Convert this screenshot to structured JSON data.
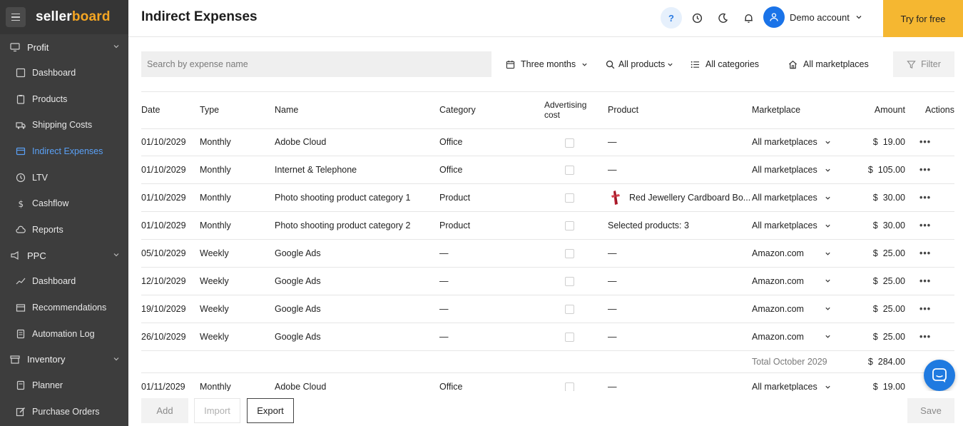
{
  "brand": {
    "part1": "seller",
    "part2": "board"
  },
  "sidebar": {
    "sections": [
      {
        "label": "Profit",
        "icon": "monitor-icon",
        "items": [
          {
            "label": "Dashboard",
            "icon": "dashboard-icon",
            "active": false
          },
          {
            "label": "Products",
            "icon": "clipboard-icon",
            "active": false
          },
          {
            "label": "Shipping Costs",
            "icon": "truck-icon",
            "active": false
          },
          {
            "label": "Indirect Expenses",
            "icon": "expenses-icon",
            "active": true
          },
          {
            "label": "LTV",
            "icon": "clock-icon",
            "active": false
          },
          {
            "label": "Cashflow",
            "icon": "dollar-icon",
            "active": false
          },
          {
            "label": "Reports",
            "icon": "cloud-icon",
            "active": false
          }
        ]
      },
      {
        "label": "PPC",
        "icon": "megaphone-icon",
        "items": [
          {
            "label": "Dashboard",
            "icon": "trend-icon",
            "active": false
          },
          {
            "label": "Recommendations",
            "icon": "box-icon",
            "active": false
          },
          {
            "label": "Automation Log",
            "icon": "log-icon",
            "active": false
          }
        ]
      },
      {
        "label": "Inventory",
        "icon": "inventory-icon",
        "items": [
          {
            "label": "Planner",
            "icon": "planner-icon",
            "active": false
          },
          {
            "label": "Purchase Orders",
            "icon": "edit-icon",
            "active": false
          }
        ]
      }
    ]
  },
  "header": {
    "title": "Indirect Expenses",
    "help": "?",
    "account_name": "Demo account",
    "try_label": "Try for free"
  },
  "toolbar": {
    "search_placeholder": "Search by expense name",
    "period": "Three months",
    "products": "All products",
    "categories": "All categories",
    "marketplaces": "All marketplaces",
    "filter": "Filter"
  },
  "table": {
    "columns": [
      "Date",
      "Type",
      "Name",
      "Category",
      "Advertising cost",
      "Product",
      "Marketplace",
      "Amount",
      "Actions"
    ],
    "rows": [
      {
        "date": "01/10/2029",
        "type": "Monthly",
        "name": "Adobe Cloud",
        "category": "Office",
        "product": "—",
        "marketplace": "All marketplaces",
        "currency": "$",
        "amount": "19.00"
      },
      {
        "date": "01/10/2029",
        "type": "Monthly",
        "name": "Internet & Telephone",
        "category": "Office",
        "product": "—",
        "marketplace": "All marketplaces",
        "currency": "$",
        "amount": "105.00"
      },
      {
        "date": "01/10/2029",
        "type": "Monthly",
        "name": "Photo shooting product category 1",
        "category": "Product",
        "product": "Red Jewellery Cardboard Bo...",
        "marketplace": "All marketplaces",
        "currency": "$",
        "amount": "30.00"
      },
      {
        "date": "01/10/2029",
        "type": "Monthly",
        "name": "Photo shooting product category 2",
        "category": "Product",
        "product": "Selected products: 3",
        "marketplace": "All marketplaces",
        "currency": "$",
        "amount": "30.00"
      },
      {
        "date": "05/10/2029",
        "type": "Weekly",
        "name": "Google Ads",
        "category": "—",
        "product": "—",
        "marketplace": "Amazon.com",
        "currency": "$",
        "amount": "25.00"
      },
      {
        "date": "12/10/2029",
        "type": "Weekly",
        "name": "Google Ads",
        "category": "—",
        "product": "—",
        "marketplace": "Amazon.com",
        "currency": "$",
        "amount": "25.00"
      },
      {
        "date": "19/10/2029",
        "type": "Weekly",
        "name": "Google Ads",
        "category": "—",
        "product": "—",
        "marketplace": "Amazon.com",
        "currency": "$",
        "amount": "25.00"
      },
      {
        "date": "26/10/2029",
        "type": "Weekly",
        "name": "Google Ads",
        "category": "—",
        "product": "—",
        "marketplace": "Amazon.com",
        "currency": "$",
        "amount": "25.00"
      }
    ],
    "total": {
      "label": "Total October 2029",
      "currency": "$",
      "amount": "284.00"
    },
    "next_row": {
      "date": "01/11/2029",
      "type": "Monthly",
      "name": "Adobe Cloud",
      "category": "Office",
      "product": "—",
      "marketplace": "All marketplaces",
      "currency": "$",
      "amount": "19.00"
    },
    "actions_glyph": "•••"
  },
  "footer": {
    "add": "Add",
    "import": "Import",
    "export": "Export",
    "save": "Save"
  },
  "colors": {
    "accent": "#5aa0f5",
    "try_button": "#f5b731",
    "sidebar": "#3d3d3d",
    "avatar": "#1a73e8"
  }
}
